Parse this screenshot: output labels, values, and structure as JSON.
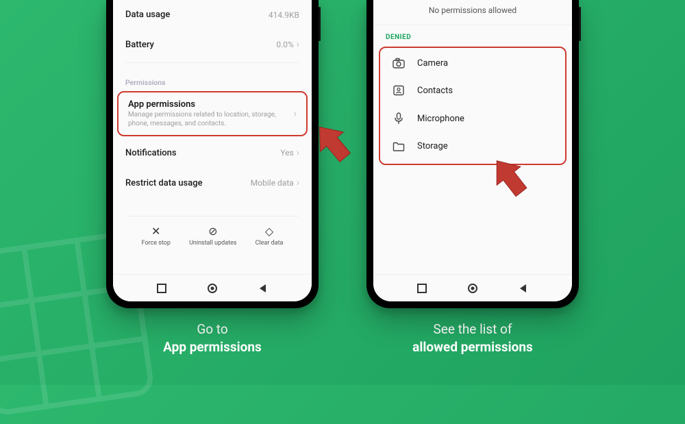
{
  "left": {
    "rows": {
      "data_usage_label": "Data usage",
      "data_usage_value": "414.9KB",
      "battery_label": "Battery",
      "battery_value": "0.0%"
    },
    "section_permissions": "Permissions",
    "app_permissions": {
      "title": "App permissions",
      "subtitle": "Manage permissions related to location, storage, phone, messages, and contacts."
    },
    "notifications_label": "Notifications",
    "notifications_value": "Yes",
    "restrict_label": "Restrict data usage",
    "restrict_value": "Mobile data",
    "actions": {
      "force_stop": "Force stop",
      "uninstall_updates": "Uninstall updates",
      "clear_data": "Clear data"
    },
    "caption_line1": "Go to",
    "caption_line2": "App permissions"
  },
  "right": {
    "no_allowed": "No permissions allowed",
    "denied_header": "DENIED",
    "items": {
      "camera": "Camera",
      "contacts": "Contacts",
      "microphone": "Microphone",
      "storage": "Storage"
    },
    "caption_line1": "See the list of",
    "caption_line2": "allowed permissions"
  },
  "colors": {
    "highlight": "#cf3a2f",
    "arrow": "#c13a31"
  }
}
